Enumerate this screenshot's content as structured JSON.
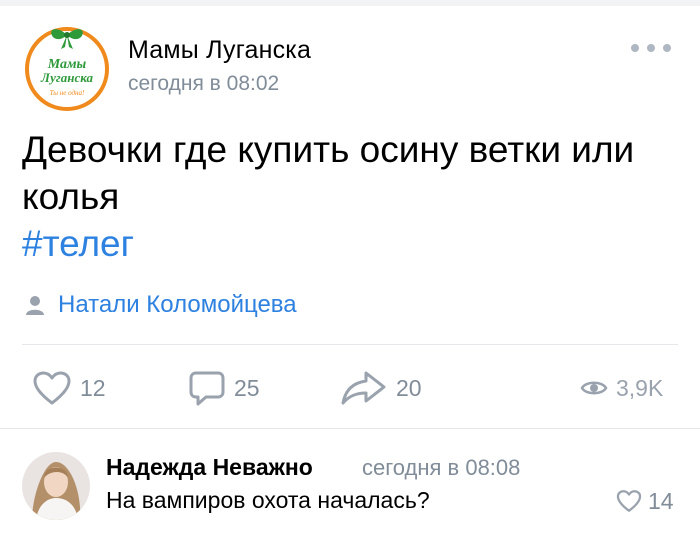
{
  "post": {
    "group_name": "Мамы Луганска",
    "time": "сегодня в 08:02",
    "text": "Девочки где купить осину ветки или колья",
    "hashtag": "#телег",
    "author": "Натали Коломойцева",
    "likes": "12",
    "comments": "25",
    "shares": "20",
    "views": "3,9K",
    "logo": {
      "line1": "Мамы",
      "line2": "Луганска",
      "tagline": "Ты не одна!"
    }
  },
  "comment": {
    "name": "Надежда Неважно",
    "time": "сегодня в 08:08",
    "text": "На вампиров охота началась?",
    "likes": "14"
  },
  "colors": {
    "link": "#2d81e0",
    "secondary": "#818c99",
    "logo_orange": "#f08a1c",
    "logo_green": "#2e9a3a"
  },
  "icons": [
    "more-icon",
    "user-icon",
    "heart-icon",
    "comment-icon",
    "share-icon",
    "eye-icon"
  ]
}
